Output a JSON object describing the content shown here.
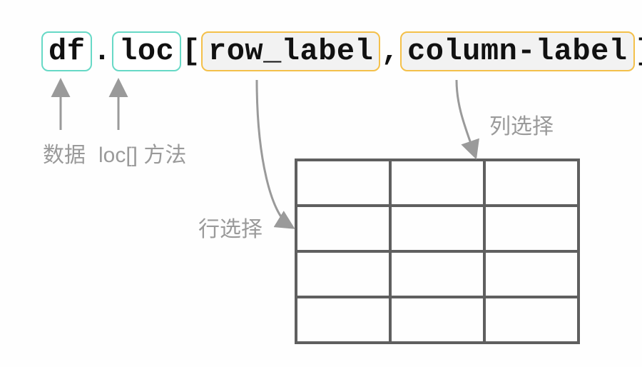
{
  "code": {
    "df": "df",
    "dot": ".",
    "loc": "loc",
    "lbracket": "[",
    "row_label": "row_label",
    "comma": ",",
    "column_label": "column-label",
    "rbracket": "]"
  },
  "labels": {
    "data": "数据",
    "loc_method": "loc[] 方法",
    "row_select": "行选择",
    "col_select": "列选择"
  },
  "grid": {
    "rows": 4,
    "cols": 3
  }
}
